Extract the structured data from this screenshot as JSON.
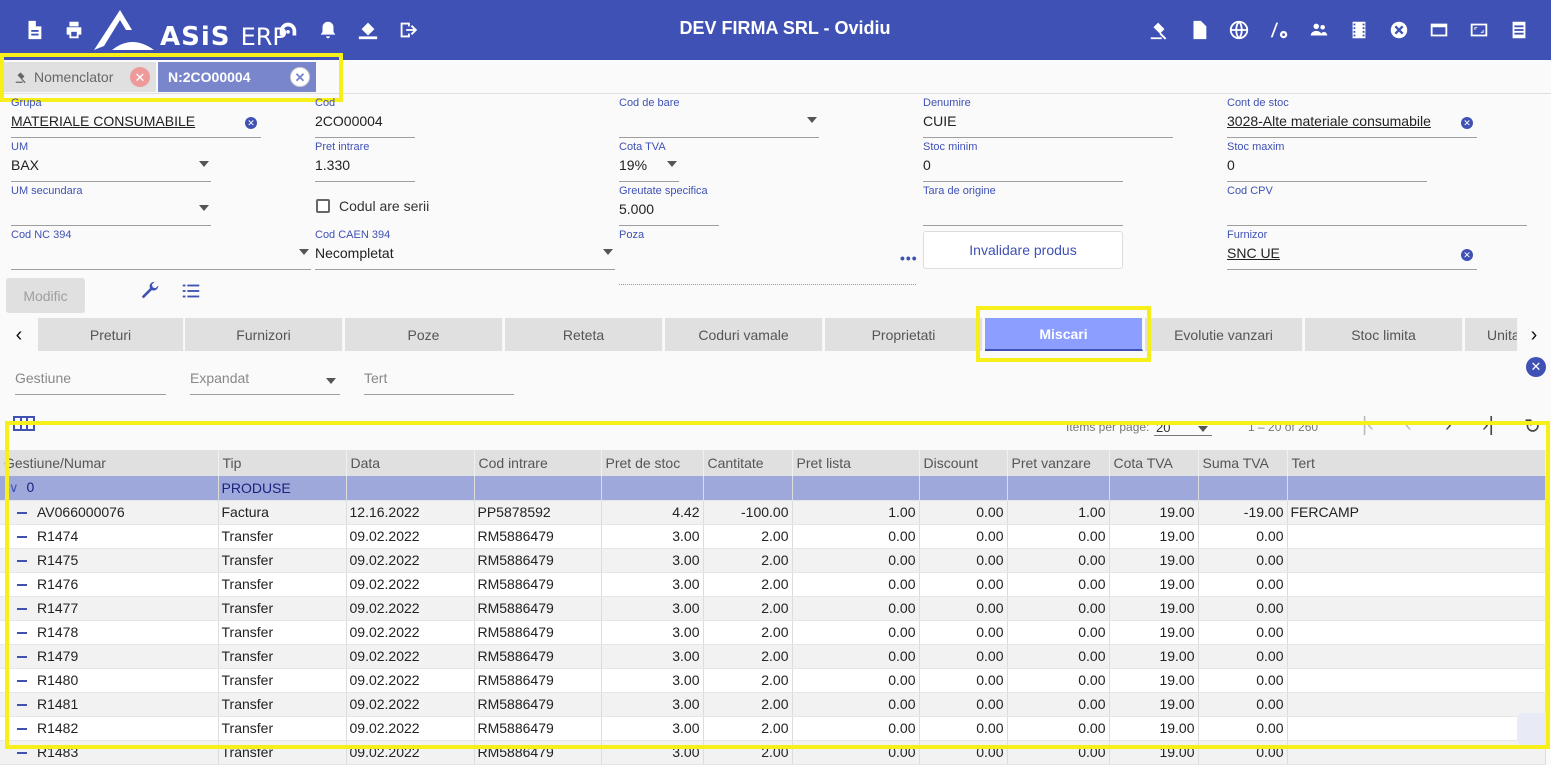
{
  "header": {
    "logo_text": "ASiS",
    "logo_suffix": "ERP",
    "title": "DEV FIRMA SRL - Ovidiu",
    "left_icons": [
      "document-icon",
      "print-icon",
      "dashboard-icon",
      "bell-icon",
      "paint-bucket-icon",
      "exit-icon"
    ],
    "right_icons": [
      "gavel-icon",
      "file-icon",
      "globe-icon",
      "settings-road-icon",
      "users-icon",
      "film-icon",
      "close-circle-icon",
      "window-icon",
      "fullscreen-icon",
      "list-icon"
    ]
  },
  "doc_tabs": [
    {
      "label": "Nomenclator"
    },
    {
      "label": "N:2CO00004"
    }
  ],
  "form": {
    "grupa": {
      "label": "Grupa",
      "value": "MATERIALE CONSUMABILE"
    },
    "cod": {
      "label": "Cod",
      "value": "2CO00004"
    },
    "cod_bare": {
      "label": "Cod de bare",
      "value": ""
    },
    "denumire": {
      "label": "Denumire",
      "value": "CUIE"
    },
    "cont_stoc": {
      "label": "Cont de stoc",
      "value": "3028-Alte materiale consumabile"
    },
    "um": {
      "label": "UM",
      "value": "BAX"
    },
    "pret_intrare": {
      "label": "Pret intrare",
      "value": "1.330"
    },
    "cota_tva": {
      "label": "Cota TVA",
      "value": "19%"
    },
    "stoc_minim": {
      "label": "Stoc minim",
      "value": "0"
    },
    "stoc_maxim": {
      "label": "Stoc maxim",
      "value": "0"
    },
    "um_secundara": {
      "label": "UM secundara",
      "value": ""
    },
    "codul_are_serii": "Codul are serii",
    "greutate": {
      "label": "Greutate specifica",
      "value": "5.000"
    },
    "tara": {
      "label": "Tara de origine",
      "value": ""
    },
    "cod_cpv": {
      "label": "Cod CPV",
      "value": ""
    },
    "cod_nc": {
      "label": "Cod NC 394",
      "value": ""
    },
    "cod_caen": {
      "label": "Cod CAEN 394",
      "value": "Necompletat"
    },
    "poza": {
      "label": "Poza",
      "value": ""
    },
    "invalidare_label": "Invalidare produs",
    "furnizor": {
      "label": "Furnizor",
      "value": "SNC UE"
    },
    "modific_label": "Modific"
  },
  "section_tabs": [
    "Preturi",
    "Furnizori",
    "Poze",
    "Reteta",
    "Coduri vamale",
    "Proprietati",
    "Miscari",
    "Evolutie vanzari",
    "Stoc limita",
    "Unita"
  ],
  "active_section": "Miscari",
  "filters": {
    "gestiune": "Gestiune",
    "expandat": "Expandat",
    "tert": "Tert"
  },
  "grid": {
    "items_per_page_label": "Items per page:",
    "items_per_page": "20",
    "range": "1 – 20 of 260",
    "columns": [
      "Gestiune/Numar",
      "Tip",
      "Data",
      "Cod intrare",
      "Pret de stoc",
      "Cantitate",
      "Pret lista",
      "Discount",
      "Pret vanzare",
      "Cota TVA",
      "Suma TVA",
      "Tert"
    ],
    "group": {
      "key": "0",
      "label": "PRODUSE"
    },
    "rows": [
      [
        "AV066000076",
        "Factura",
        "12.16.2022",
        "PP5878592",
        "4.42",
        "-100.00",
        "1.00",
        "0.00",
        "1.00",
        "19.00",
        "-19.00",
        "FERCAMP"
      ],
      [
        "R1474",
        "Transfer",
        "09.02.2022",
        "RM5886479",
        "3.00",
        "2.00",
        "0.00",
        "0.00",
        "0.00",
        "19.00",
        "0.00",
        ""
      ],
      [
        "R1475",
        "Transfer",
        "09.02.2022",
        "RM5886479",
        "3.00",
        "2.00",
        "0.00",
        "0.00",
        "0.00",
        "19.00",
        "0.00",
        ""
      ],
      [
        "R1476",
        "Transfer",
        "09.02.2022",
        "RM5886479",
        "3.00",
        "2.00",
        "0.00",
        "0.00",
        "0.00",
        "19.00",
        "0.00",
        ""
      ],
      [
        "R1477",
        "Transfer",
        "09.02.2022",
        "RM5886479",
        "3.00",
        "2.00",
        "0.00",
        "0.00",
        "0.00",
        "19.00",
        "0.00",
        ""
      ],
      [
        "R1478",
        "Transfer",
        "09.02.2022",
        "RM5886479",
        "3.00",
        "2.00",
        "0.00",
        "0.00",
        "0.00",
        "19.00",
        "0.00",
        ""
      ],
      [
        "R1479",
        "Transfer",
        "09.02.2022",
        "RM5886479",
        "3.00",
        "2.00",
        "0.00",
        "0.00",
        "0.00",
        "19.00",
        "0.00",
        ""
      ],
      [
        "R1480",
        "Transfer",
        "09.02.2022",
        "RM5886479",
        "3.00",
        "2.00",
        "0.00",
        "0.00",
        "0.00",
        "19.00",
        "0.00",
        ""
      ],
      [
        "R1481",
        "Transfer",
        "09.02.2022",
        "RM5886479",
        "3.00",
        "2.00",
        "0.00",
        "0.00",
        "0.00",
        "19.00",
        "0.00",
        ""
      ],
      [
        "R1482",
        "Transfer",
        "09.02.2022",
        "RM5886479",
        "3.00",
        "2.00",
        "0.00",
        "0.00",
        "0.00",
        "19.00",
        "0.00",
        ""
      ],
      [
        "R1483",
        "Transfer",
        "09.02.2022",
        "RM5886479",
        "3.00",
        "2.00",
        "0.00",
        "0.00",
        "0.00",
        "19.00",
        "0.00",
        ""
      ]
    ]
  }
}
